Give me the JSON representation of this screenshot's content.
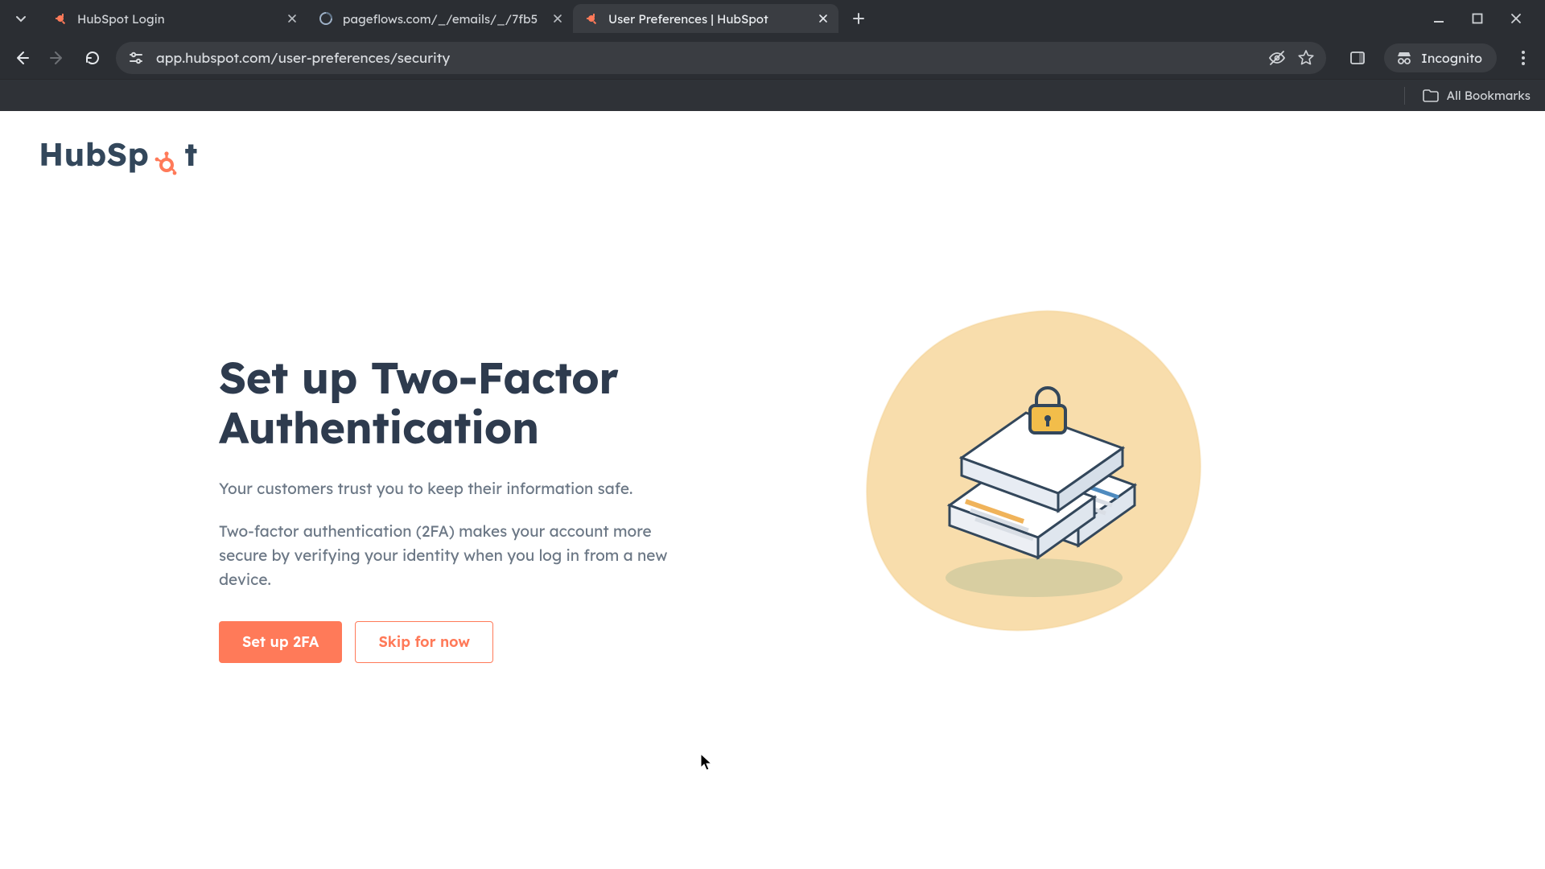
{
  "browser": {
    "tabs": [
      {
        "title": "HubSpot Login",
        "active": false
      },
      {
        "title": "pageflows.com/_/emails/_/7fb5",
        "active": false
      },
      {
        "title": "User Preferences | HubSpot",
        "active": true
      }
    ],
    "url": "app.hubspot.com/user-preferences/security",
    "incognito_label": "Incognito",
    "all_bookmarks_label": "All Bookmarks"
  },
  "page": {
    "logo_text_parts": {
      "a": "HubSp",
      "b": "t"
    },
    "heading": "Set up Two-Factor Authentication",
    "para1": "Your customers trust you to keep their information safe.",
    "para2": "Two-factor authentication (2FA) makes your account more secure by verifying your identity when you log in from a new device.",
    "primary_btn": "Set up 2FA",
    "secondary_btn": "Skip for now"
  },
  "colors": {
    "accent": "#ff7a59",
    "text_primary": "#2e3b4e",
    "text_secondary": "#6b7785",
    "chrome_bg": "#2b2e33",
    "illus_blob": "#f7d9a3"
  }
}
